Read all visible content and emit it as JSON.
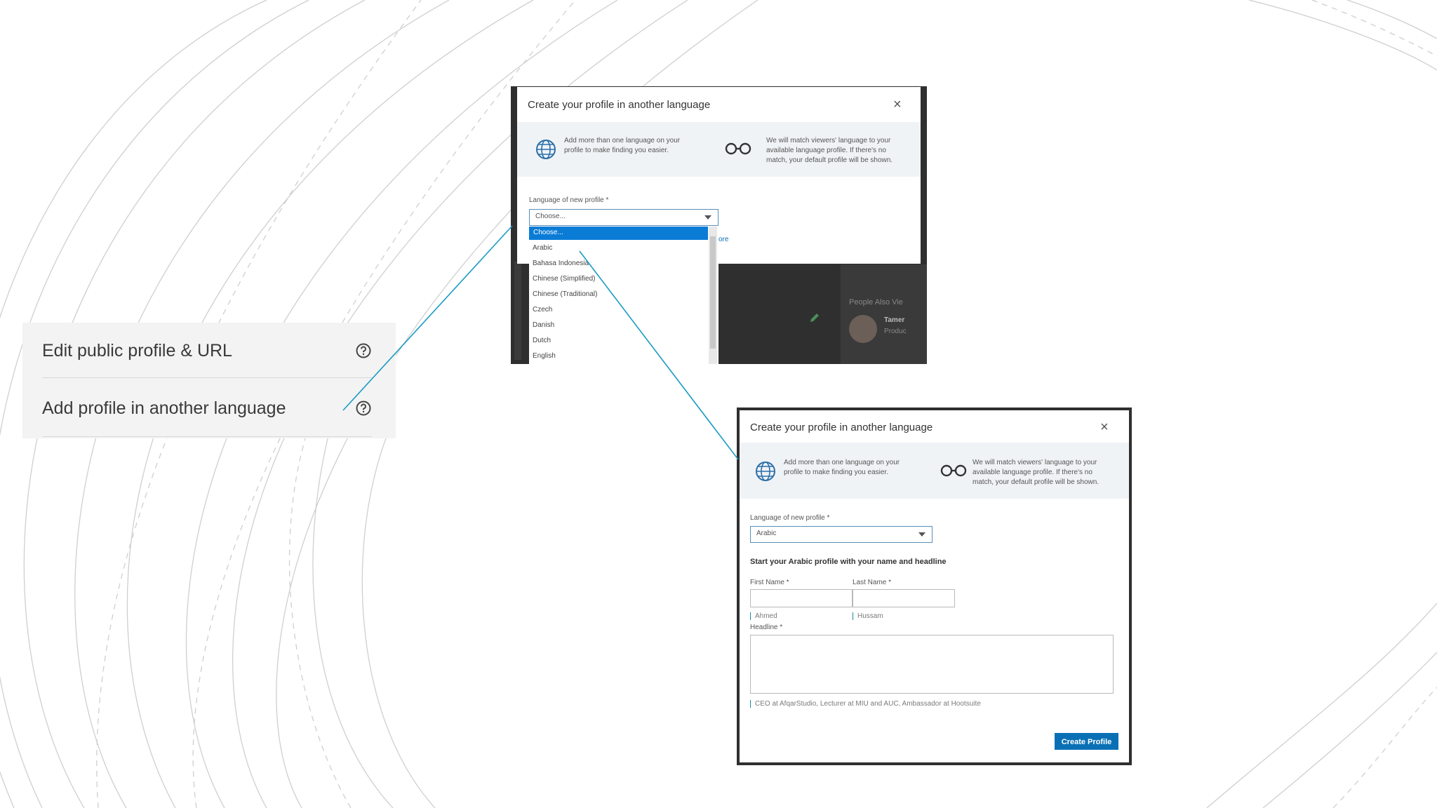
{
  "settings_panel": {
    "rows": [
      {
        "label": "Edit public profile & URL"
      },
      {
        "label": "Add profile in another language"
      }
    ]
  },
  "modal_dropdown": {
    "title": "Create your profile in another language",
    "close": "×",
    "info_left": "Add more than one language on your profile to make finding you easier.",
    "info_right": "We will match viewers' language to your available language profile. If there's no match, your default profile will be shown.",
    "language_label": "Language of new profile *",
    "select_value": "Choose...",
    "options": [
      "Choose...",
      "Arabic",
      "Bahasa Indonesia",
      "Chinese (Simplified)",
      "Chinese (Traditional)",
      "Czech",
      "Danish",
      "Dutch",
      "English"
    ],
    "background_text": {
      "people_also_viewed": "People Also Vie",
      "partial_name": "Tamer",
      "partial_sub": "Produc",
      "partial_link": "ore"
    }
  },
  "modal_form": {
    "title": "Create your profile in another language",
    "close": "×",
    "info_left": "Add more than one language on your profile to make finding you easier.",
    "info_right": "We will match viewers' language to your available language profile. If there's no match, your default profile will be shown.",
    "language_label": "Language of new profile *",
    "select_value": "Arabic",
    "section_heading": "Start your Arabic profile with your name and headline",
    "first_name_label": "First Name *",
    "last_name_label": "Last Name *",
    "first_name_hint": "Ahmed",
    "last_name_hint": "Hussam",
    "headline_label": "Headline *",
    "headline_hint": "CEO at AfqarStudio, Lecturer at MIU and AUC, Ambassador at Hootsuite",
    "create_button": "Create Profile"
  },
  "colors": {
    "accent": "#0a70b5",
    "selection": "#0a7cd6",
    "connector": "#1a9bc4"
  }
}
